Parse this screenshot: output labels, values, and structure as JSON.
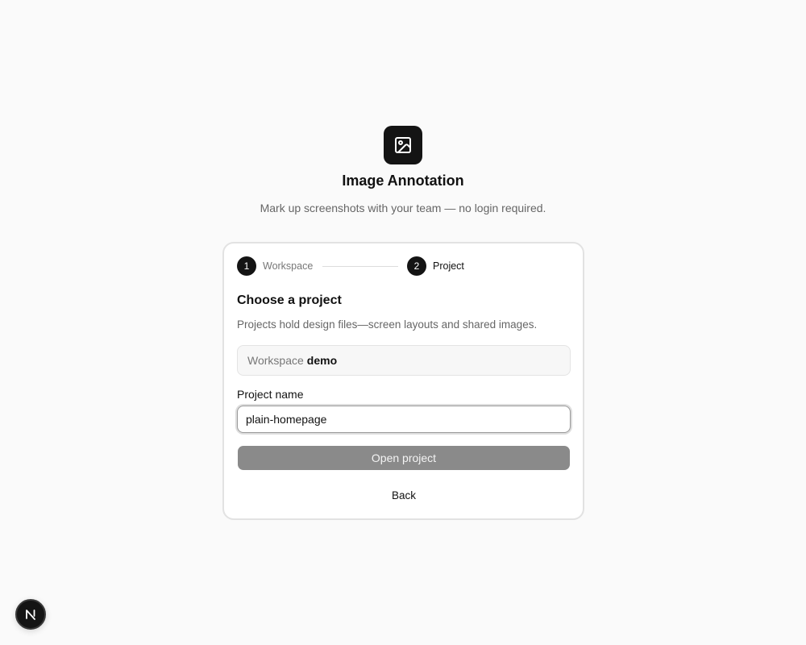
{
  "app": {
    "title": "Image Annotation",
    "subtitle": "Mark up screenshots with your team — no login required.",
    "logo_icon": "image-icon"
  },
  "steps": [
    {
      "number": "1",
      "label": "Workspace",
      "state": "completed"
    },
    {
      "number": "2",
      "label": "Project",
      "state": "active"
    }
  ],
  "form": {
    "title": "Choose a project",
    "description": "Projects hold design files—screen layouts and shared images.",
    "workspace_prefix": "Workspace",
    "workspace_name": "demo",
    "project_label": "Project name",
    "project_value": "plain-homepage",
    "open_button": "Open project",
    "back_button": "Back"
  },
  "badge": {
    "letter": "N",
    "icon": "nextjs-logo-icon"
  },
  "colors": {
    "background": "#fafafa",
    "accent": "#141414",
    "button_disabled": "#8a8a8a",
    "muted_text": "#666666"
  }
}
